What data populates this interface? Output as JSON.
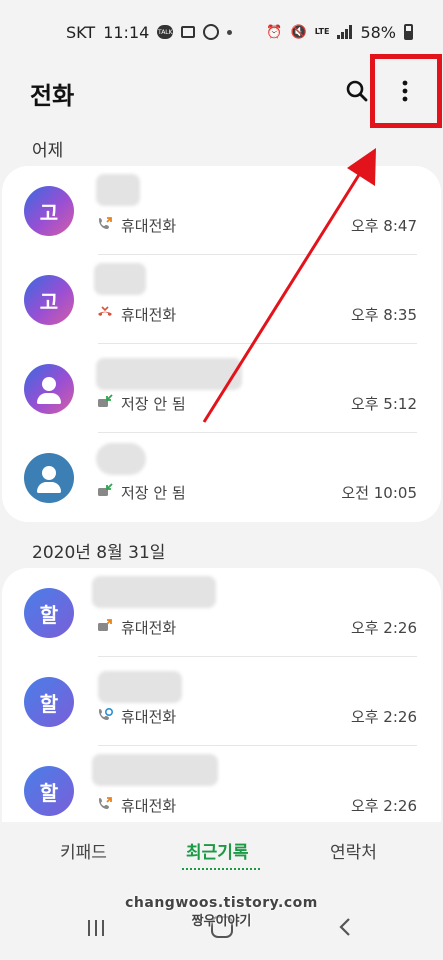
{
  "status": {
    "carrier": "SKT",
    "time": "11:14",
    "bubble_text": "TALK",
    "network": "LTE",
    "battery": "58%"
  },
  "header": {
    "title": "전화"
  },
  "sections": [
    {
      "label": "어제",
      "calls": [
        {
          "avatar_text": "고",
          "type": "휴대전화",
          "time": "오후 8:47"
        },
        {
          "avatar_text": "고",
          "type": "휴대전화",
          "time": "오후 8:35"
        },
        {
          "avatar_text": "",
          "type": "저장 안 됨",
          "time": "오후 5:12"
        },
        {
          "avatar_text": "",
          "type": "저장 안 됨",
          "time": "오전 10:05"
        }
      ]
    },
    {
      "label": "2020년 8월 31일",
      "calls": [
        {
          "avatar_text": "할",
          "type": "휴대전화",
          "time": "오후 2:26"
        },
        {
          "avatar_text": "할",
          "type": "휴대전화",
          "time": "오후 2:26"
        },
        {
          "avatar_text": "할",
          "type": "휴대전화",
          "time": "오후 2:26"
        }
      ]
    }
  ],
  "tabs": {
    "keypad": "키패드",
    "recent": "최근기록",
    "contacts": "연락처"
  },
  "watermark": {
    "line1": "changwoos.tistory.com",
    "line2": "짱우이야기"
  },
  "colors": {
    "accent_green": "#1d9a45",
    "annotation_red": "#e3131b"
  }
}
